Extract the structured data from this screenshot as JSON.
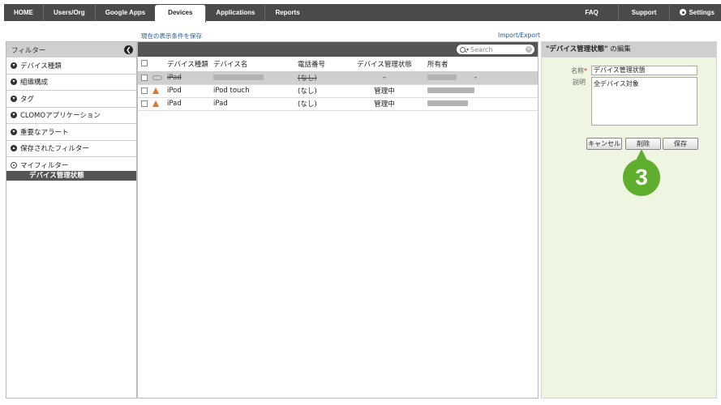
{
  "nav": {
    "items": [
      "HOME",
      "Users/Org",
      "Google Apps",
      "Devices",
      "Applications",
      "Reports"
    ],
    "active": "Devices",
    "right": [
      "FAQ",
      "Support",
      "Settings"
    ]
  },
  "links": {
    "save_view": "現在の表示条件を保存",
    "import_export": "Import/Export"
  },
  "sidebar": {
    "title": "フィルター",
    "collapse_glyph": "❮",
    "items": [
      "デバイス種類",
      "組織構成",
      "タグ",
      "CLOMOアプリケーション",
      "重要なアラート",
      "保存されたフィルター"
    ],
    "my_filter_title": "マイフィルター",
    "my_filter_selected": "デバイス管理状態"
  },
  "search": {
    "placeholder": "Search"
  },
  "table": {
    "headers": [
      "デバイス種類",
      "デバイス名",
      "電話番号",
      "デバイス管理状態",
      "所有者"
    ],
    "rows": [
      {
        "type": "iPad",
        "name": "",
        "phone": "(なし)",
        "status": "–",
        "owner": "",
        "extra": "-",
        "state": "unmanaged"
      },
      {
        "type": "iPod",
        "name": "iPod touch",
        "phone": "(なし)",
        "status": "管理中",
        "owner": "",
        "extra": "",
        "state": "warning"
      },
      {
        "type": "iPad",
        "name": "iPad",
        "phone": "(なし)",
        "status": "管理中",
        "owner": "",
        "extra": "",
        "state": "warning"
      }
    ]
  },
  "panel": {
    "title_quoted": "\"デバイス管理状態\"",
    "title_suffix": " の編集",
    "name_label": "名称",
    "required_mark": "*",
    "name_value": "デバイス管理状態",
    "desc_label": "説明",
    "desc_value": "全デバイス対象",
    "buttons": {
      "cancel": "キャンセル",
      "delete": "削除",
      "save": "保存"
    }
  },
  "annotation": {
    "step": "3",
    "color": "#5fae2d"
  }
}
